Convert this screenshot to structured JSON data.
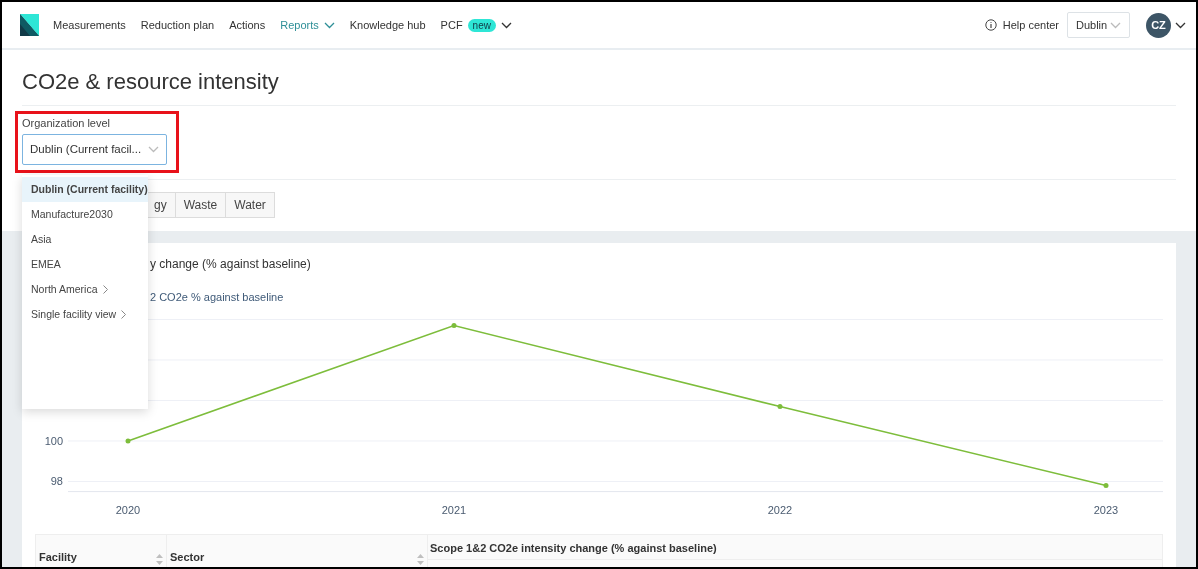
{
  "nav": {
    "items": [
      {
        "label": "Measurements",
        "kind": "link",
        "selected": false
      },
      {
        "label": "Reduction plan",
        "kind": "link",
        "selected": false
      },
      {
        "label": "Actions",
        "kind": "link",
        "selected": false
      },
      {
        "label": "Reports",
        "kind": "dropdown",
        "selected": true
      },
      {
        "label": "Knowledge hub",
        "kind": "link",
        "selected": false
      },
      {
        "label": "PCF",
        "kind": "dropdown",
        "selected": false,
        "badge": "new"
      }
    ],
    "help": "Help center",
    "facility_select": "Dublin",
    "avatar": "CZ"
  },
  "page_title": "CO2e & resource intensity",
  "org_level": {
    "label": "Organization level",
    "value": "Dublin (Current facil...",
    "menu": [
      {
        "label": "Dublin (Current facility)",
        "selected": true,
        "has_children": false
      },
      {
        "label": "Manufacture2030",
        "selected": false,
        "has_children": false
      },
      {
        "label": "Asia",
        "selected": false,
        "has_children": false
      },
      {
        "label": "EMEA",
        "selected": false,
        "has_children": false
      },
      {
        "label": "North America",
        "selected": false,
        "has_children": true
      },
      {
        "label": "Single facility view",
        "selected": false,
        "has_children": true
      }
    ]
  },
  "tabs": [
    "gy",
    "Waste",
    "Water"
  ],
  "chart": {
    "chart_data": {
      "type": "line",
      "title": "y change (% against baseline)",
      "categories": [
        "2020",
        "2021",
        "2022",
        "2023"
      ],
      "series": [
        {
          "name": "2 CO2e % against baseline",
          "color": "#7dbd3b",
          "values": [
            100,
            105.7,
            101.7,
            97.8
          ]
        }
      ],
      "yticks": [
        98,
        100
      ],
      "ylim": [
        97.5,
        106
      ]
    }
  },
  "table": {
    "columns": [
      {
        "label": "Facility",
        "sortable": true
      },
      {
        "label": "Sector",
        "sortable": true
      },
      {
        "label": "Scope 1&2 CO2e intensity change (% against baseline)",
        "sortable": false
      }
    ]
  }
}
